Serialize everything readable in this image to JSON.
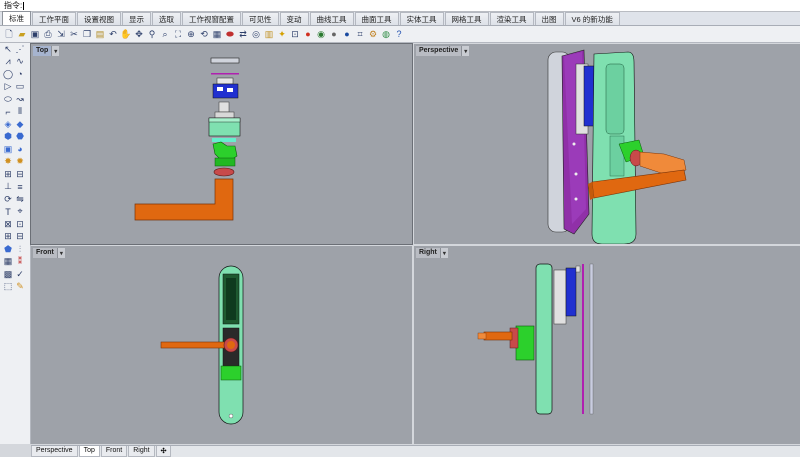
{
  "command": {
    "label": "指令:"
  },
  "menu_tabs": [
    "标准",
    "工作平面",
    "设置视图",
    "显示",
    "选取",
    "工作视窗配置",
    "可见性",
    "变动",
    "曲线工具",
    "曲面工具",
    "实体工具",
    "网格工具",
    "渲染工具",
    "出图",
    "V6 的新功能"
  ],
  "active_menu_tab": "标准",
  "viewports": {
    "top": {
      "title": "Top",
      "dropdown": "▾"
    },
    "perspective": {
      "title": "Perspective",
      "dropdown": "▾"
    },
    "front": {
      "title": "Front",
      "dropdown": "▾"
    },
    "right": {
      "title": "Right",
      "dropdown": "▾"
    }
  },
  "bottom_tabs": [
    "Perspective",
    "Top",
    "Front",
    "Right"
  ],
  "bottom_add": "✣",
  "toolbar_icons": [
    "new-file-icon",
    "open-file-icon",
    "save-icon",
    "print-icon",
    "import-icon",
    "cut-icon",
    "copy-icon",
    "paste-icon",
    "undo-icon",
    "pan-icon",
    "rotate-view-icon",
    "zoom-icon",
    "zoom-window-icon",
    "zoom-extents-icon",
    "zoom-selected-icon",
    "rotate-icon",
    "grid-icon",
    "cplane-icon",
    "move-icon",
    "osnap-icon",
    "layer-icon",
    "light-bulb-icon",
    "lock-icon",
    "color-icon",
    "material-icon",
    "render-sphere-icon",
    "shaded-sphere-icon",
    "dimension-icon",
    "options-gear-icon",
    "web-globe-icon",
    "help-icon"
  ],
  "colors": {
    "viewport_bg": "#9ea2a9",
    "handle_orange": "#e06810",
    "green_part": "#7fe0b0",
    "green_gear": "#2cd02c",
    "blue_part": "#1f3cc8",
    "purple_part": "#8a2aa0",
    "dark_edge": "#1a1a1a"
  }
}
